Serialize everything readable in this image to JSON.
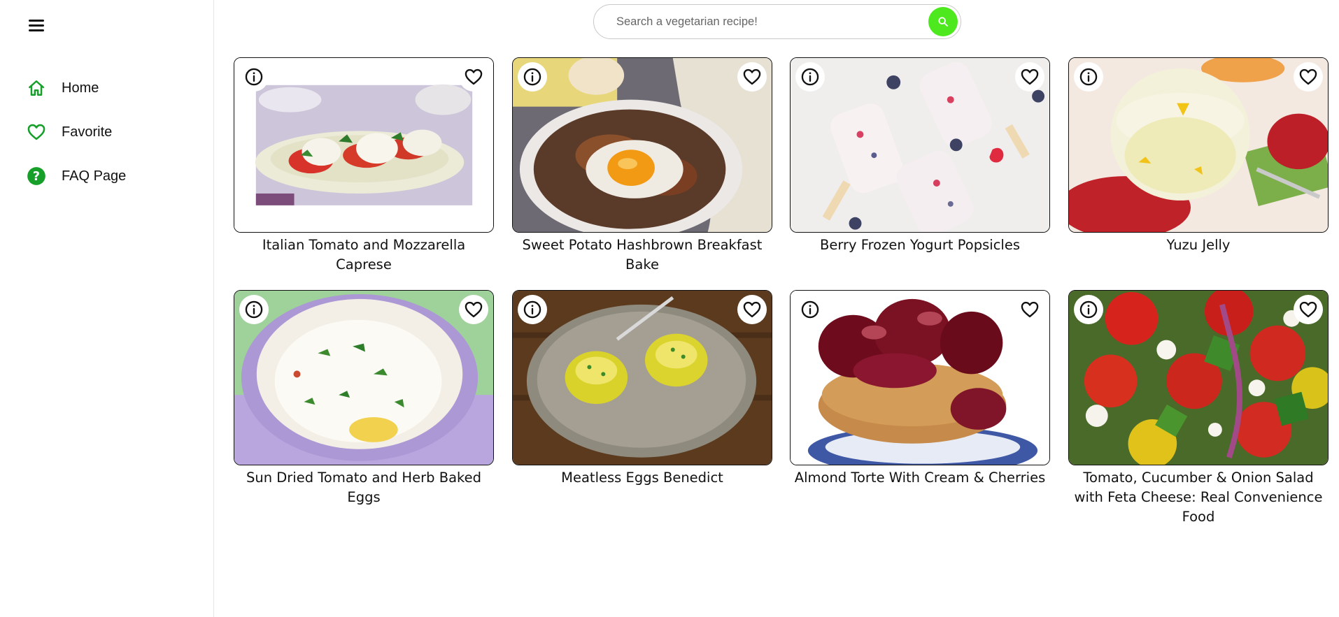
{
  "sidebar": {
    "items": [
      {
        "label": "Home",
        "icon": "home-icon"
      },
      {
        "label": "Favorite",
        "icon": "heart-icon"
      },
      {
        "label": "FAQ Page",
        "icon": "help-icon"
      }
    ],
    "accent": "#16a02a"
  },
  "search": {
    "placeholder": "Search a vegetarian recipe!",
    "value": "",
    "button_color": "#4ee81f"
  },
  "recipes": [
    {
      "title": "Italian Tomato and Mozzarella Caprese"
    },
    {
      "title": "Sweet Potato Hashbrown Breakfast Bake"
    },
    {
      "title": "Berry Frozen Yogurt Popsicles"
    },
    {
      "title": "Yuzu Jelly"
    },
    {
      "title": "Sun Dried Tomato and Herb Baked Eggs"
    },
    {
      "title": "Meatless Eggs Benedict"
    },
    {
      "title": "Almond Torte With Cream & Cherries"
    },
    {
      "title": "Tomato, Cucumber & Onion Salad with Feta Cheese: Real Convenience Food"
    }
  ]
}
